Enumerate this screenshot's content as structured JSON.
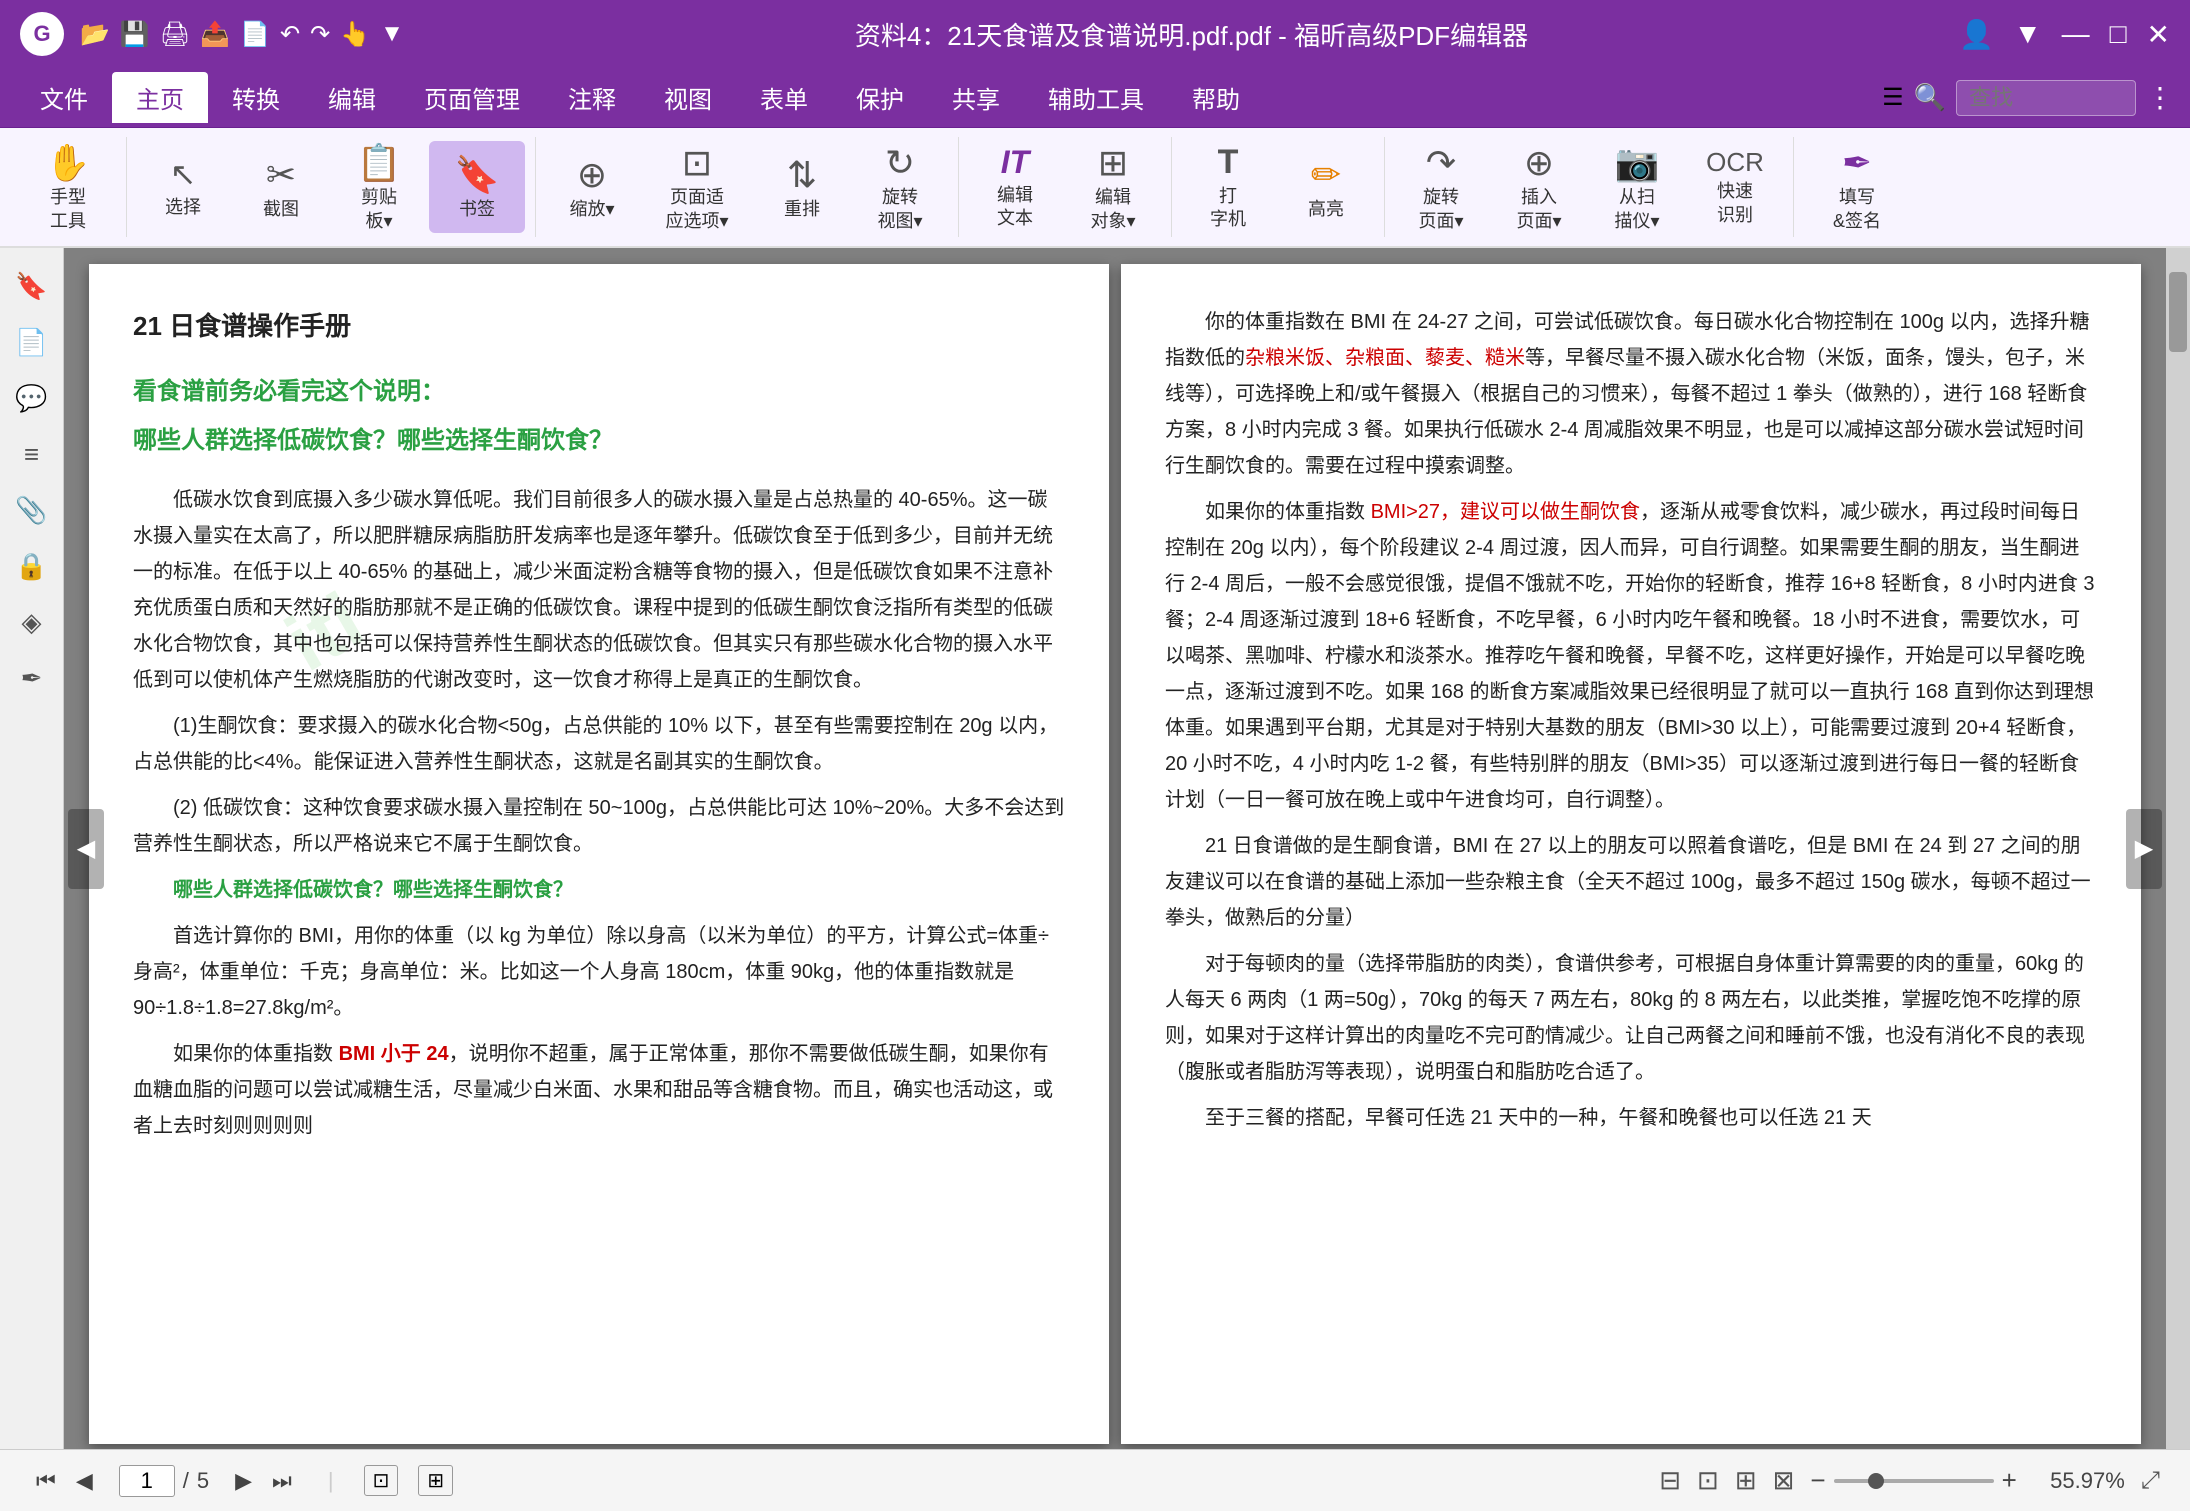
{
  "titleBar": {
    "appName": "福昕高级PDF编辑器",
    "fileTitle": "资料4：21天食谱及食谱说明.pdf.pdf - 福昕高级PDF编辑器",
    "appIconLabel": "G",
    "windowControls": {
      "minimize": "—",
      "maximize": "□",
      "close": "✕"
    }
  },
  "menuBar": {
    "items": [
      {
        "label": "文件",
        "active": false
      },
      {
        "label": "主页",
        "active": true
      },
      {
        "label": "转换",
        "active": false
      },
      {
        "label": "编辑",
        "active": false
      },
      {
        "label": "页面管理",
        "active": false
      },
      {
        "label": "注释",
        "active": false
      },
      {
        "label": "视图",
        "active": false
      },
      {
        "label": "表单",
        "active": false
      },
      {
        "label": "保护",
        "active": false
      },
      {
        "label": "共享",
        "active": false
      },
      {
        "label": "辅助工具",
        "active": false
      },
      {
        "label": "帮助",
        "active": false
      }
    ],
    "searchPlaceholder": "查找",
    "moreIcon": "⋮"
  },
  "toolbar": {
    "groups": [
      {
        "items": [
          {
            "icon": "✋",
            "label": "手型\n工具",
            "active": false
          }
        ]
      },
      {
        "items": [
          {
            "icon": "↖",
            "label": "选择",
            "active": false
          },
          {
            "icon": "✂",
            "label": "截图",
            "active": false
          },
          {
            "icon": "📋",
            "label": "剪贴\n板",
            "active": false
          },
          {
            "icon": "🔖",
            "label": "书签",
            "active": true
          }
        ]
      },
      {
        "items": [
          {
            "icon": "⊕",
            "label": "缩放",
            "active": false
          },
          {
            "icon": "⊡",
            "label": "页面适\n应选项",
            "active": false
          },
          {
            "icon": "⇅",
            "label": "重排",
            "active": false
          },
          {
            "icon": "↻",
            "label": "旋转\n视图",
            "active": false
          }
        ]
      },
      {
        "items": [
          {
            "icon": "IT",
            "label": "编辑\n文本",
            "active": false
          },
          {
            "icon": "⊞",
            "label": "编辑\n对象",
            "active": false
          }
        ]
      },
      {
        "items": [
          {
            "icon": "T",
            "label": "打\n字机",
            "active": false
          },
          {
            "icon": "✏",
            "label": "高亮",
            "active": false,
            "color": "orange"
          }
        ]
      },
      {
        "items": [
          {
            "icon": "↷",
            "label": "旋转\n页面",
            "active": false
          },
          {
            "icon": "⊕",
            "label": "插入\n页面",
            "active": false
          },
          {
            "icon": "📷",
            "label": "从扫\n描仪",
            "active": false
          },
          {
            "icon": "◈",
            "label": "快速\n识别",
            "active": false
          }
        ]
      },
      {
        "items": [
          {
            "icon": "✒",
            "label": "填写\n&签名",
            "active": false,
            "color": "purple"
          }
        ]
      }
    ]
  },
  "leftSidebar": {
    "icons": [
      {
        "name": "bookmark-sidebar-icon",
        "symbol": "🔖"
      },
      {
        "name": "page-thumbnail-icon",
        "symbol": "📄"
      },
      {
        "name": "comment-icon",
        "symbol": "💬"
      },
      {
        "name": "layers-icon",
        "symbol": "≡"
      },
      {
        "name": "attachment-icon",
        "symbol": "📎"
      },
      {
        "name": "lock-icon",
        "symbol": "🔒"
      },
      {
        "name": "stamp-icon",
        "symbol": "◈"
      },
      {
        "name": "signature-icon",
        "symbol": "✒"
      }
    ]
  },
  "leftPage": {
    "title": "21 日食谱操作手册",
    "sectionHeading": "看食谱前务必看完这个说明：",
    "sectionQuestion": "哪些人群选择低碳饮食？哪些选择生酮饮食？",
    "paragraphs": [
      "低碳水饮食到底摄入多少碳水算低呢。我们目前很多人的碳水摄入量是占总热量的 40-65%。这一碳水摄入量实在太高了，所以肥胖糖尿病脂肪肝发病率也是逐年攀升。低碳饮食至于低到多少，目前并无统一的标准。在低于以上 40-65% 的基础上，减少米面淀粉含糖等食物的摄入，但是低碳饮食如果不注意补充优质蛋白质和天然好的脂肪那就不是正确的低碳饮食。课程中提到的低碳生酮饮食泛指所有类型的低碳水化合物饮食，其中也包括可以保持营养性生酮状态的低碳饮食。但其实只有那些碳水化合物的摄入水平低到可以使机体产生燃烧脂肪的代谢改变时，这一饮食才称得上是真正的生酮饮食。",
      "(1)生酮饮食：要求摄入的碳水化合物<50g，占总供能的 10% 以下，甚至有些需要控制在 20g 以内，占总供能的比<4%。能保证进入营养性生酮状态，这就是名副其实的生酮饮食。",
      "(2) 低碳饮食：这种饮食要求碳水摄入量控制在 50~100g，占总供能比可达 10%~20%。大多不会达到营养性生酮状态，所以严格说来它不属于生酮饮食。",
      "哪些人群选择低碳饮食？哪些选择生酮饮食？首选计算你的 BMI，用你的体重（以 kg 为单位）除以身高（以米为单位）的平方，计算公式=体重÷身高²，体重单位：千克；身高单位：米。比如这一个人身高 180cm，体重 90kg，他的体重指数就是 90÷1.8÷1.8=27.8kg/m²。",
      "如果你的体重指数 BMI 小于 24，说明你不超重，属于正常体重，那你不需要做低碳生酮，如果你有血糖血脂的问题可以尝试减糖生活，尽量减少白米面、水果和甜品等含糖食物。而且，确实也活动这，或者上去时刻则则则则"
    ],
    "bmiSmallLabel": "BMI 小于 24",
    "watermark1": "iti"
  },
  "rightPage": {
    "paragraphs": [
      "你的体重指数在 BMI 在 24-27 之间，可尝试低碳饮食。每日碳水化合物控制在 100g 以内，选择升糖指数低的杂粮米饭、杂粮面、藜麦、糙米等，早餐尽量不摄入碳水化合物（米饭，面条，馒头，包子，米线等），可选择晚上和/或午餐摄入（根据自己的习惯来），每餐不超过 1 拳头（做熟的），进行 168 轻断食方案，8 小时内完成 3 餐。如果执行低碳水 2-4 周减脂效果不明显，也是可以减掉这部分碳水尝试短时间行生酮饮食的。需要在过程中摸索调整。",
      "如果你的体重指数 BMI>27，建议可以做生酮饮食，逐渐从戒零食饮料，减少碳水，再过段时间每日控制在 20g 以内），每个阶段建议 2-4 周过渡，因人而异，可自行调整。如果需要生酮的朋友，当生酮进行 2-4 周后，一般不会感觉很饿，提倡不饿就不吃，开始你的轻断食，推荐 16+8 轻断食，8 小时内进食 3 餐；2-4 周逐渐过渡到 18+6 轻断食，不吃早餐，6 小时内吃午餐和晚餐。18 小时不进食，需要饮水，可以喝茶、黑咖啡、柠檬水和淡茶水。推荐吃午餐和晚餐，早餐不吃，这样更好操作，开始是可以早餐吃晚一点，逐渐过渡到不吃。如果 168 的断食方案减脂效果已经很明显了就可以一直执行 168 直到你达到理想体重。如果遇到平台期，尤其是对于特别大基数的朋友（BMI>30 以上），可能需要过渡到 20+4 轻断食，20 小时不吃，4 小时内吃 1-2 餐，有些特别胖的朋友（BMI>35）可以逐渐过渡到进行每日一餐的轻断食计划（一日一餐可放在晚上或中午进食均可，自行调整）。",
      "21 日食谱做的是生酮食谱，BMI 在 27 以上的朋友可以照着食谱吃，但是 BMI 在 24 到 27 之间的朋友建议可以在食谱的基础上添加一些杂粮主食（全天不超过 100g，最多不超过 150g 碳水，每顿不超过一拳头，做熟后的分量）",
      "对于每顿肉的量（选择带脂肪的肉类），食谱供参考，可根据自身体重计算需要的肉的重量，60kg 的人每天 6 两肉（1 两=50g），70kg 的每天 7 两左右，80kg 的 8 两左右，以此类推，掌握吃饱不吃撑的原则，如果对于这样计算出的肉量吃不完可酌情减少。让自己两餐之间和睡前不饿，也没有消化不良的表现（腹胀或者脂肪泻等表现），说明蛋白和脂肪吃合适了。",
      "至于三餐的搭配，早餐可任选 21 天中的一种，午餐和晚餐也可以任选 21 天"
    ],
    "redTexts": [
      "杂粮米饭、杂粮面、藜麦、糙米",
      "BMI>27，建议可以做生酮饮食"
    ]
  },
  "statusBar": {
    "firstPageBtn": "⏮",
    "prevPageBtn": "◀",
    "pageInput": "1",
    "pageSeparator": "/",
    "totalPages": "5",
    "nextPageBtn": "▶",
    "lastPageBtn": "⏭",
    "extractPageBtn": "⊡",
    "insertPageBtn": "⊞",
    "viewBtns": [
      "⊟",
      "⊡",
      "⊞",
      "⊠"
    ],
    "zoomOutBtn": "−",
    "zoomInBtn": "+",
    "zoomLevel": "55.97%",
    "expandBtn": "⤢"
  }
}
